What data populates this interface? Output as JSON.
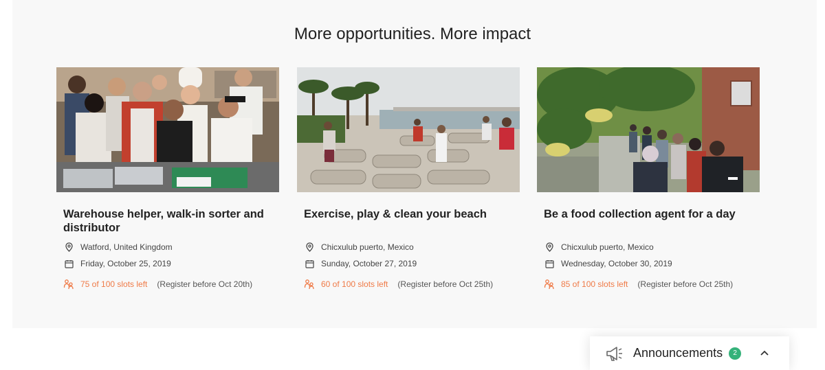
{
  "section": {
    "heading": "More opportunities. More impact"
  },
  "cards": [
    {
      "title": "Warehouse helper, walk-in sorter and distributor",
      "location": "Watford, United Kingdom",
      "date": "Friday, October 25, 2019",
      "slots": "75 of 100 slots left",
      "register": "(Register before Oct 20th)"
    },
    {
      "title": "Exercise, play & clean your beach",
      "location": "Chicxulub puerto, Mexico",
      "date": "Sunday, October 27, 2019",
      "slots": "60 of 100 slots left",
      "register": "(Register before Oct 25th)"
    },
    {
      "title": "Be a food collection agent for a day",
      "location": "Chicxulub puerto, Mexico",
      "date": "Wednesday, October 30, 2019",
      "slots": "85 of 100 slots left",
      "register": "(Register before Oct 25th)"
    }
  ],
  "announcements": {
    "label": "Announcements",
    "count": "2"
  },
  "colors": {
    "accent_orange": "#ef7a47",
    "badge_green": "#35b27a",
    "section_bg": "#f8f8f8"
  },
  "icons": {
    "location": "map-pin-icon",
    "date": "calendar-icon",
    "slots": "people-icon",
    "announce": "megaphone-icon",
    "toggle": "chevron-up-icon"
  }
}
